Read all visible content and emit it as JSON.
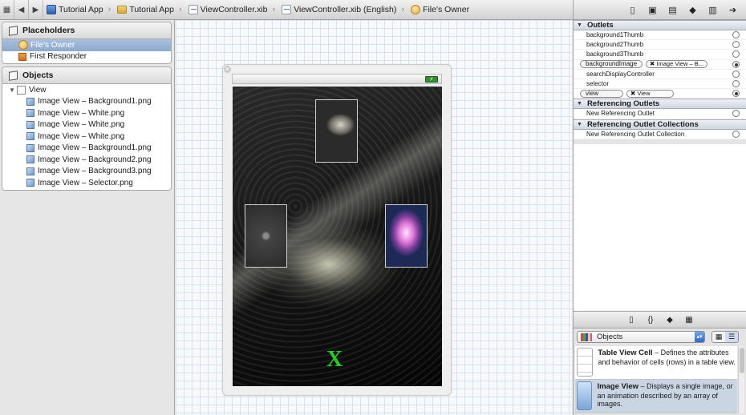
{
  "breadcrumb": {
    "items": [
      "Tutorial App",
      "Tutorial App",
      "ViewController.xib",
      "ViewController.xib (English)",
      "File's Owner"
    ]
  },
  "left": {
    "placeholders": {
      "title": "Placeholders",
      "items": [
        "File's Owner",
        "First Responder"
      ]
    },
    "objects": {
      "title": "Objects",
      "root": "View",
      "items": [
        "Image View – Background1.png",
        "Image View – White.png",
        "Image View – White.png",
        "Image View – White.png",
        "Image View – Background1.png",
        "Image View – Background2.png",
        "Image View – Background3.png",
        "Image View – Selector.png"
      ]
    }
  },
  "canvas": {
    "close": "✕",
    "battery": "⚡",
    "x_label": "X"
  },
  "inspector": {
    "outlets_title": "Outlets",
    "outlets": [
      {
        "name": "background1Thumb",
        "connection": ""
      },
      {
        "name": "background2Thumb",
        "connection": ""
      },
      {
        "name": "background3Thumb",
        "connection": ""
      },
      {
        "name": "backgroundImage",
        "connection": "Image View – B..."
      },
      {
        "name": "searchDisplayController",
        "connection": ""
      },
      {
        "name": "selector",
        "connection": ""
      },
      {
        "name": "view",
        "connection": "View"
      }
    ],
    "ref_title": "Referencing Outlets",
    "ref_item": "New Referencing Outlet",
    "refcol_title": "Referencing Outlet Collections",
    "refcol_item": "New Referencing Outlet Collection"
  },
  "library": {
    "selector": "Objects",
    "items": [
      {
        "title": "Table View Cell",
        "desc": " – Defines the attributes and behavior of cells (rows) in a table view."
      },
      {
        "title": "Image View",
        "desc": " – Displays a single image, or an animation described by an array of images."
      }
    ]
  }
}
